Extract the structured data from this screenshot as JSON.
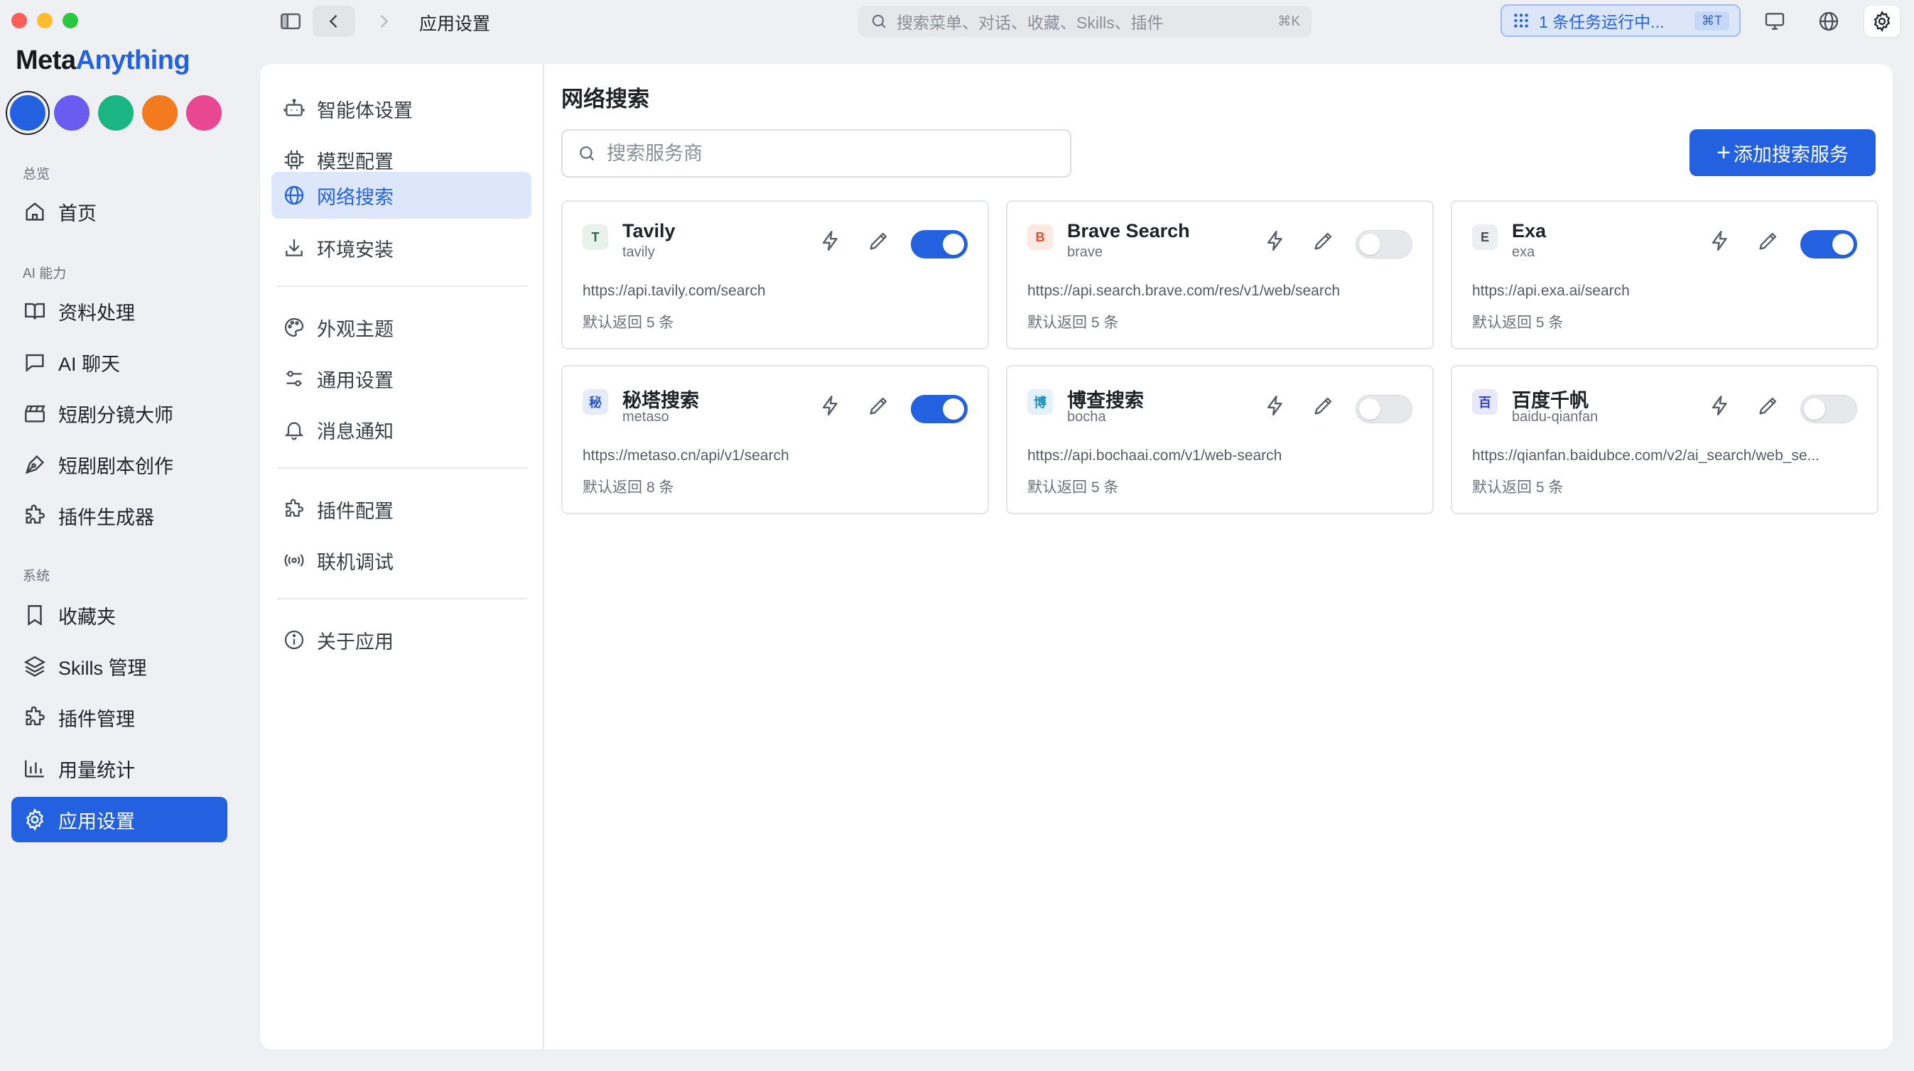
{
  "window": {
    "title": "应用设置",
    "traffic_colors": [
      "#ff5f57",
      "#febc2e",
      "#28c840"
    ]
  },
  "topbar": {
    "search_placeholder": "搜索菜单、对话、收藏、Skills、插件",
    "search_shortcut": "⌘K",
    "task_label": "1 条任务运行中...",
    "task_shortcut": "⌘T"
  },
  "brand": {
    "part1": "Meta",
    "part2": "Anything"
  },
  "theme_swatches": [
    "#2361e0",
    "#6a5cf0",
    "#1bb584",
    "#f47a1f",
    "#e94791"
  ],
  "sidebar": {
    "sections": [
      {
        "label": "总览",
        "items": [
          {
            "label": "首页",
            "icon": "home-icon"
          }
        ]
      },
      {
        "label": "AI 能力",
        "items": [
          {
            "label": "资料处理",
            "icon": "book-icon"
          },
          {
            "label": "AI 聊天",
            "icon": "chat-icon"
          },
          {
            "label": "短剧分镜大师",
            "icon": "clapper-icon"
          },
          {
            "label": "短剧剧本创作",
            "icon": "pen-nib-icon"
          },
          {
            "label": "插件生成器",
            "icon": "puzzle-icon"
          }
        ]
      },
      {
        "label": "系统",
        "items": [
          {
            "label": "收藏夹",
            "icon": "bookmark-icon"
          },
          {
            "label": "Skills 管理",
            "icon": "layers-icon"
          },
          {
            "label": "插件管理",
            "icon": "puzzle-icon"
          },
          {
            "label": "用量统计",
            "icon": "bar-chart-icon"
          },
          {
            "label": "应用设置",
            "icon": "gear-icon",
            "active": true
          }
        ]
      }
    ]
  },
  "settings_nav": {
    "groups": [
      [
        {
          "label": "智能体设置",
          "icon": "robot-icon"
        },
        {
          "label": "模型配置",
          "icon": "chip-icon"
        },
        {
          "label": "网络搜索",
          "icon": "globe-icon",
          "active": true
        },
        {
          "label": "环境安装",
          "icon": "download-icon"
        }
      ],
      [
        {
          "label": "外观主题",
          "icon": "palette-icon"
        },
        {
          "label": "通用设置",
          "icon": "sliders-icon"
        },
        {
          "label": "消息通知",
          "icon": "bell-icon"
        }
      ],
      [
        {
          "label": "插件配置",
          "icon": "puzzle-icon"
        },
        {
          "label": "联机调试",
          "icon": "broadcast-icon"
        }
      ],
      [
        {
          "label": "关于应用",
          "icon": "info-icon"
        }
      ]
    ]
  },
  "content": {
    "title": "网络搜索",
    "search_placeholder": "搜索服务商",
    "add_button": "添加搜索服务",
    "providers": [
      {
        "logo": "T",
        "logo_bg": "#e8f1ec",
        "logo_color": "#2a6b48",
        "name": "Tavily",
        "slug": "tavily",
        "url": "https://api.tavily.com/search",
        "meta": "默认返回 5 条",
        "enabled": true
      },
      {
        "logo": "B",
        "logo_bg": "#fde8e4",
        "logo_color": "#e0502d",
        "name": "Brave Search",
        "slug": "brave",
        "url": "https://api.search.brave.com/res/v1/web/search",
        "meta": "默认返回 5 条",
        "enabled": false
      },
      {
        "logo": "E",
        "logo_bg": "#eceef1",
        "logo_color": "#4a4f57",
        "name": "Exa",
        "slug": "exa",
        "url": "https://api.exa.ai/search",
        "meta": "默认返回 5 条",
        "enabled": true
      },
      {
        "logo": "秘",
        "logo_bg": "#e4ebfb",
        "logo_color": "#2d56c9",
        "name": "秘塔搜索",
        "slug": "metaso",
        "url": "https://metaso.cn/api/v1/search",
        "meta": "默认返回 8 条",
        "enabled": true
      },
      {
        "logo": "博",
        "logo_bg": "#e2f2f8",
        "logo_color": "#1f8fb8",
        "name": "博查搜索",
        "slug": "bocha",
        "url": "https://api.bochaai.com/v1/web-search",
        "meta": "默认返回 5 条",
        "enabled": false
      },
      {
        "logo": "百",
        "logo_bg": "#e7e9fb",
        "logo_color": "#3140c7",
        "name": "百度千帆",
        "slug": "baidu-qianfan",
        "url": "https://qianfan.baidubce.com/v2/ai_search/web_se...",
        "meta": "默认返回 5 条",
        "enabled": false
      }
    ]
  }
}
